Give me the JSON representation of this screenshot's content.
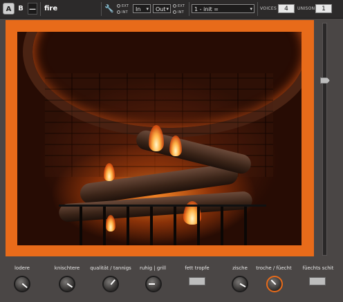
{
  "toolbar": {
    "tab_a": "A",
    "tab_b": "B",
    "minimize": "—",
    "patch_name": "fire",
    "wrench_icon": "wrench-icon",
    "radio1": {
      "ext": "EXT",
      "int": "INT"
    },
    "in_select": "In",
    "out_select": "Out",
    "radio2": {
      "ext": "EXT",
      "int": "INT"
    },
    "preset_select": "1 - init =",
    "voices_label": "VOICES",
    "voices_value": "4",
    "unison_label": "UNISON",
    "unison_value": "1"
  },
  "controls": {
    "knob1": "lodere",
    "knob2": "knischtere",
    "knob3": "qualität / tannigs",
    "knob4": "ruhig | grill",
    "button1": "fett tropfe",
    "knob5": "zische",
    "knob6": "troche / füecht",
    "button2": "füechts schit"
  },
  "colors": {
    "accent": "#e86b1a",
    "background": "#4a4645",
    "toolbar": "#2c2a2a"
  }
}
